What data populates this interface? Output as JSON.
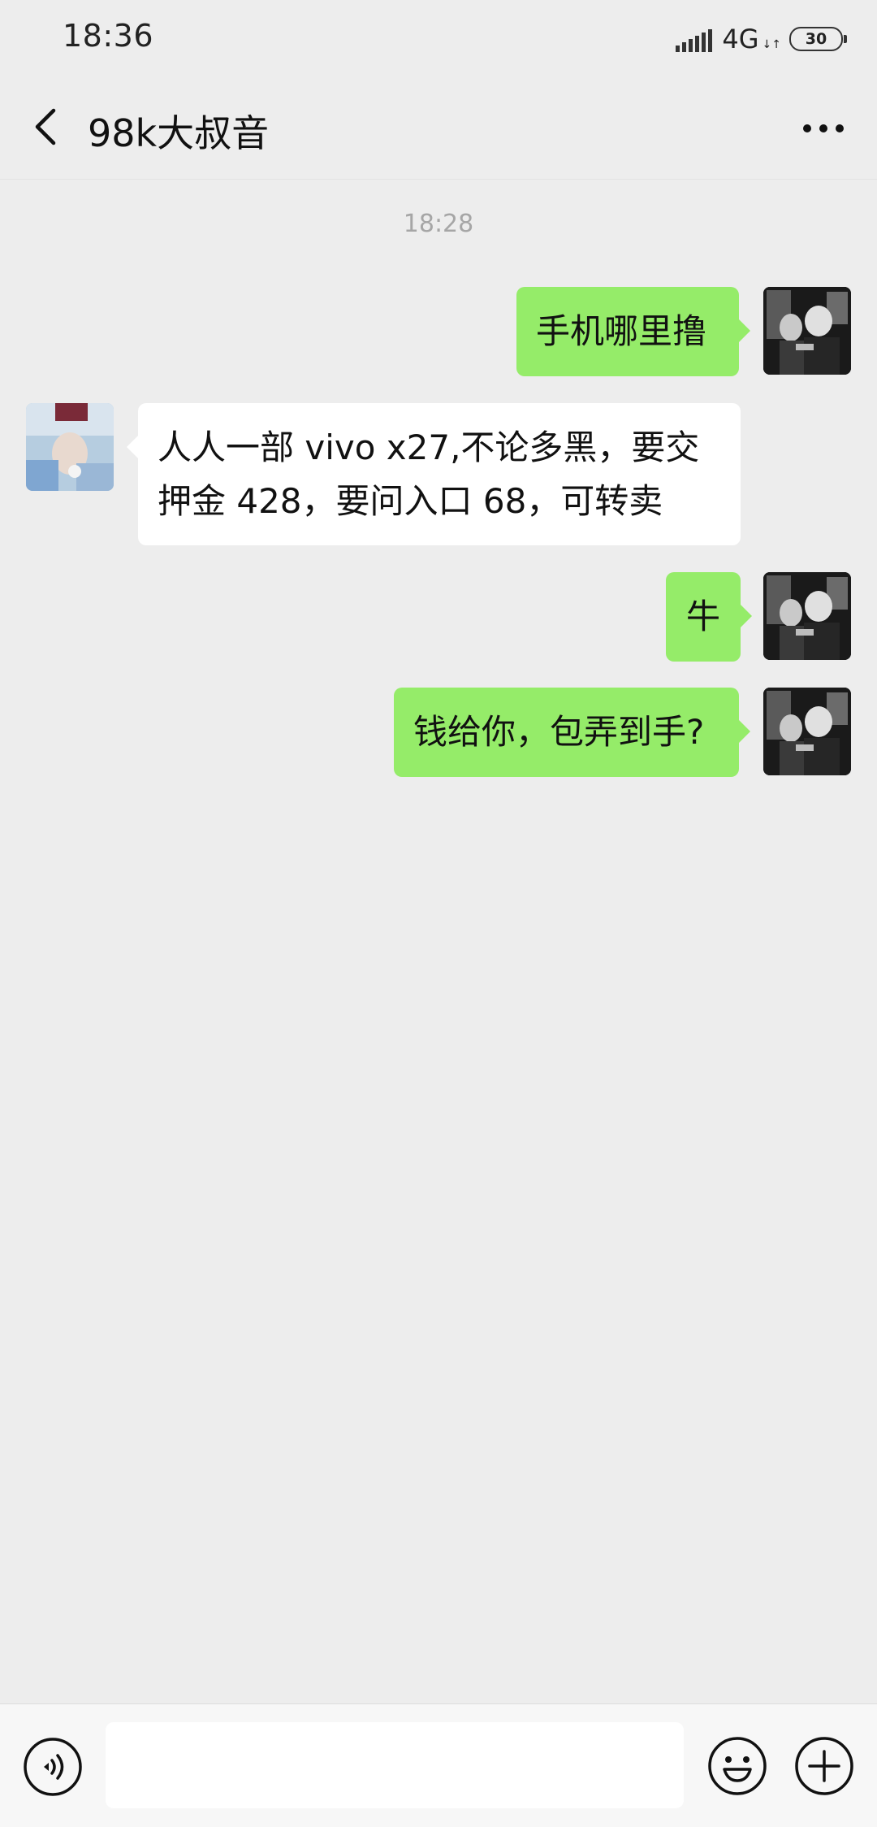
{
  "status_bar": {
    "time": "18:36",
    "network": "4G",
    "battery": "30"
  },
  "header": {
    "title": "98k大叔音",
    "back_icon": "chevron-left-icon",
    "more_icon": "more-dots-icon"
  },
  "chat": {
    "timestamp": "18:28",
    "messages": [
      {
        "sender": "me",
        "text": "手机哪里撸"
      },
      {
        "sender": "other",
        "line1": "人人一部 vivo x27,不论多黑，要交",
        "line2": "押金 428，要问入口 68，可转卖"
      },
      {
        "sender": "me",
        "text": "牛"
      },
      {
        "sender": "me",
        "text": "钱给你，包弄到手?"
      }
    ]
  },
  "input_bar": {
    "placeholder": "",
    "voice_icon": "voice-icon",
    "emoji_icon": "emoji-icon",
    "plus_icon": "plus-icon"
  },
  "colors": {
    "background": "#ededed",
    "my_bubble": "#95ec69",
    "other_bubble": "#ffffff",
    "timestamp": "#a6a6a6"
  }
}
